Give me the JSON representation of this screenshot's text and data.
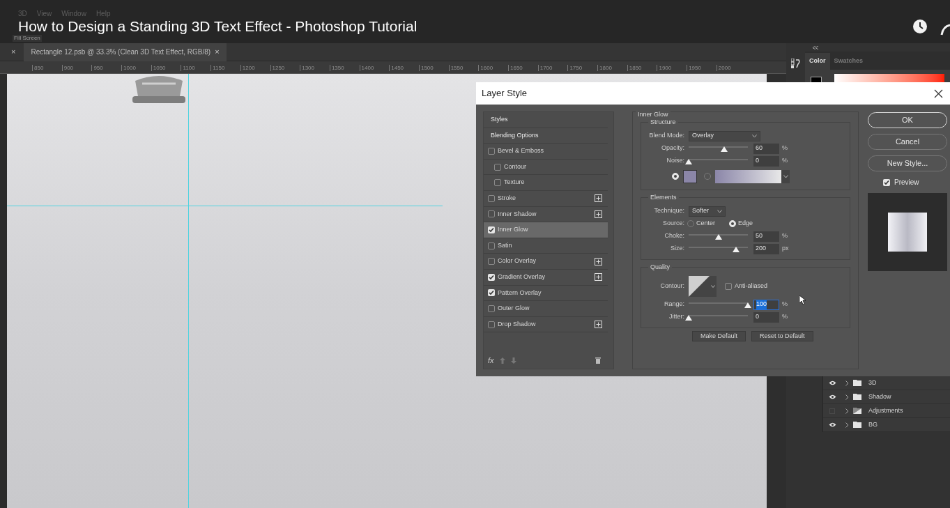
{
  "video": {
    "title": "How to Design a Standing 3D Text Effect - Photoshop Tutorial"
  },
  "menu": [
    {
      "label": "3D"
    },
    {
      "label": "View"
    },
    {
      "label": "Window"
    },
    {
      "label": "Help"
    }
  ],
  "fill_screen_button": "Fill Screen",
  "document_tab": {
    "close_all": "×",
    "title": "Rectangle 12.psb @ 33.3% (Clean 3D Text Effect, RGB/8)",
    "close": "×"
  },
  "ruler": {
    "labels": [
      "850",
      "900",
      "950",
      "1000",
      "1050",
      "1100",
      "1150",
      "1200",
      "1250",
      "1300",
      "1350",
      "1400",
      "1450",
      "1500",
      "1550",
      "1600",
      "1650",
      "1700",
      "1750",
      "1800",
      "1850",
      "1900",
      "1950",
      "2000"
    ]
  },
  "color_panel": {
    "tabs": [
      {
        "label": "Color",
        "selected": true
      },
      {
        "label": "Swatches",
        "selected": false
      }
    ]
  },
  "layers": [
    {
      "name": "3D",
      "visible": true,
      "kind": "folder"
    },
    {
      "name": "Shadow",
      "visible": true,
      "kind": "folder"
    },
    {
      "name": "Adjustments",
      "visible": false,
      "kind": "adjustment"
    },
    {
      "name": "BG",
      "visible": true,
      "kind": "folder"
    }
  ],
  "dialog": {
    "title": "Layer Style",
    "styles": [
      {
        "label": "Styles",
        "kind": "heading"
      },
      {
        "label": "Blending Options",
        "kind": "heading"
      },
      {
        "label": "Bevel & Emboss",
        "kind": "effect",
        "checked": false,
        "selected": false,
        "addable": false,
        "children": [
          {
            "label": "Contour",
            "kind": "effect",
            "checked": false,
            "selected": false,
            "addable": false
          },
          {
            "label": "Texture",
            "kind": "effect",
            "checked": false,
            "selected": false,
            "addable": false
          }
        ]
      },
      {
        "label": "Stroke",
        "kind": "effect",
        "checked": false,
        "selected": false,
        "addable": true
      },
      {
        "label": "Inner Shadow",
        "kind": "effect",
        "checked": false,
        "selected": false,
        "addable": true
      },
      {
        "label": "Inner Glow",
        "kind": "effect",
        "checked": true,
        "selected": true,
        "addable": false
      },
      {
        "label": "Satin",
        "kind": "effect",
        "checked": false,
        "selected": false,
        "addable": false
      },
      {
        "label": "Color Overlay",
        "kind": "effect",
        "checked": false,
        "selected": false,
        "addable": true
      },
      {
        "label": "Gradient Overlay",
        "kind": "effect",
        "checked": true,
        "selected": false,
        "addable": true
      },
      {
        "label": "Pattern Overlay",
        "kind": "effect",
        "checked": true,
        "selected": false,
        "addable": false
      },
      {
        "label": "Outer Glow",
        "kind": "effect",
        "checked": false,
        "selected": false,
        "addable": false
      },
      {
        "label": "Drop Shadow",
        "kind": "effect",
        "checked": false,
        "selected": false,
        "addable": true
      }
    ],
    "fx_label": "fx",
    "inner_glow": {
      "title": "Inner Glow",
      "structure": {
        "title": "Structure",
        "blend_mode": {
          "label": "Blend Mode:",
          "value": "Overlay"
        },
        "opacity": {
          "label": "Opacity:",
          "level": 0.6,
          "value": "60",
          "unit": "%"
        },
        "noise": {
          "label": "Noise:",
          "level": 0,
          "value": "0",
          "unit": "%"
        },
        "fill_types": [
          {
            "kind": "color",
            "selected": true,
            "color": "#8b86a8"
          },
          {
            "kind": "gradient",
            "selected": false
          }
        ]
      },
      "elements": {
        "title": "Elements",
        "technique": {
          "label": "Technique:",
          "value": "Softer"
        },
        "source": {
          "label": "Source:",
          "options": [
            {
              "label": "Center",
              "selected": false
            },
            {
              "label": "Edge",
              "selected": true
            }
          ]
        },
        "choke": {
          "label": "Choke:",
          "level": 0.5,
          "value": "50",
          "unit": "%"
        },
        "size": {
          "label": "Size:",
          "level": 0.8,
          "value": "200",
          "unit": "px"
        }
      },
      "quality": {
        "title": "Quality",
        "contour": {
          "label": "Contour:"
        },
        "anti_aliased": {
          "label": "Anti-aliased",
          "checked": false
        },
        "range": {
          "label": "Range:",
          "level": 1,
          "value": "100",
          "unit": "%",
          "text_selected": true
        },
        "jitter": {
          "label": "Jitter:",
          "level": 0,
          "value": "0",
          "unit": "%"
        }
      },
      "buttons": [
        "Make Default",
        "Reset to Default"
      ]
    },
    "actions": [
      {
        "label": "OK",
        "default": true
      },
      {
        "label": "Cancel",
        "default": false
      },
      {
        "label": "New Style...",
        "default": false
      }
    ],
    "preview": {
      "label": "Preview",
      "checked": true
    }
  }
}
